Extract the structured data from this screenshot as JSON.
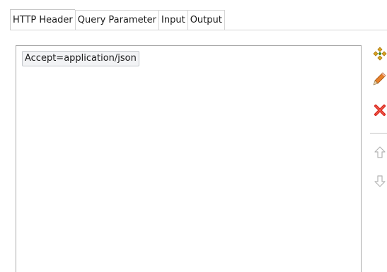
{
  "tabs": [
    {
      "label": "HTTP Header",
      "active": true
    },
    {
      "label": "Query Parameter",
      "active": false
    },
    {
      "label": "Input",
      "active": false
    },
    {
      "label": "Output",
      "active": false
    }
  ],
  "list": {
    "items": [
      "Accept=application/json"
    ]
  },
  "toolbar": {
    "add_icon": "add-icon",
    "edit_icon": "pencil-icon",
    "delete_icon": "delete-icon",
    "up_icon": "arrow-up-icon",
    "down_icon": "arrow-down-icon",
    "colors": {
      "add": "#d9a321",
      "edit": "#e6802a",
      "delete": "#d8241c",
      "arrows": "#b4b4b4"
    }
  }
}
